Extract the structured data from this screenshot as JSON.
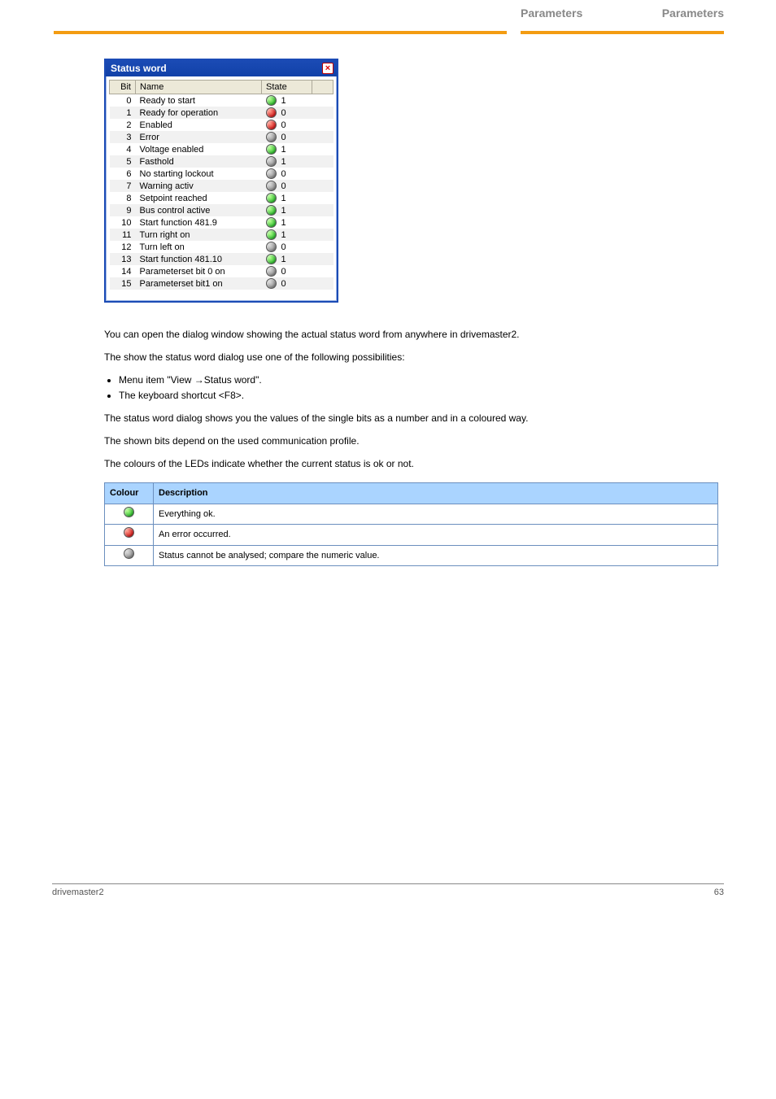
{
  "header": {
    "tab_label": "Parameters",
    "right_label": "Parameters"
  },
  "status_window": {
    "title": "Status word",
    "columns": {
      "bit": "Bit",
      "name": "Name",
      "state": "State"
    },
    "rows": [
      {
        "bit": "0",
        "name": "Ready to start",
        "color": "green",
        "value": "1"
      },
      {
        "bit": "1",
        "name": "Ready for operation",
        "color": "red",
        "value": "0"
      },
      {
        "bit": "2",
        "name": "Enabled",
        "color": "red",
        "value": "0"
      },
      {
        "bit": "3",
        "name": "Error",
        "color": "grey",
        "value": "0"
      },
      {
        "bit": "4",
        "name": "Voltage enabled",
        "color": "green",
        "value": "1"
      },
      {
        "bit": "5",
        "name": "Fasthold",
        "color": "grey",
        "value": "1"
      },
      {
        "bit": "6",
        "name": "No starting lockout",
        "color": "grey",
        "value": "0"
      },
      {
        "bit": "7",
        "name": "Warning activ",
        "color": "grey",
        "value": "0"
      },
      {
        "bit": "8",
        "name": "Setpoint reached",
        "color": "green",
        "value": "1"
      },
      {
        "bit": "9",
        "name": "Bus control active",
        "color": "green",
        "value": "1"
      },
      {
        "bit": "10",
        "name": "Start function 481.9",
        "color": "green",
        "value": "1"
      },
      {
        "bit": "11",
        "name": "Turn right on",
        "color": "green",
        "value": "1"
      },
      {
        "bit": "12",
        "name": "Turn left on",
        "color": "grey",
        "value": "0"
      },
      {
        "bit": "13",
        "name": "Start function 481.10",
        "color": "green",
        "value": "1"
      },
      {
        "bit": "14",
        "name": "Parameterset bit 0 on",
        "color": "grey",
        "value": "0"
      },
      {
        "bit": "15",
        "name": "Parameterset bit1 on",
        "color": "grey",
        "value": "0"
      }
    ]
  },
  "text": {
    "p1": "You can open the dialog window showing the actual status word from anywhere in drivemaster2.",
    "p2": "The show the status word dialog use one of the following possibilities:",
    "li1": "Menu item \"View →Status word\".",
    "li2": "The keyboard shortcut <F8>.",
    "p3": "The status word dialog shows you the values of the single bits as a number and in a coloured way.",
    "p4": "The shown bits depend on the used communication profile.",
    "p5": "The colours of the LEDs indicate whether the current status is ok or not."
  },
  "legend": {
    "headers": {
      "color": "Colour",
      "desc": "Description"
    },
    "rows": [
      {
        "color": "green",
        "desc": "Everything ok."
      },
      {
        "color": "red",
        "desc": "An error occurred."
      },
      {
        "color": "grey",
        "desc": "Status cannot be analysed; compare the numeric value."
      }
    ]
  },
  "footer": {
    "left": "drivemaster2",
    "right": "63"
  }
}
